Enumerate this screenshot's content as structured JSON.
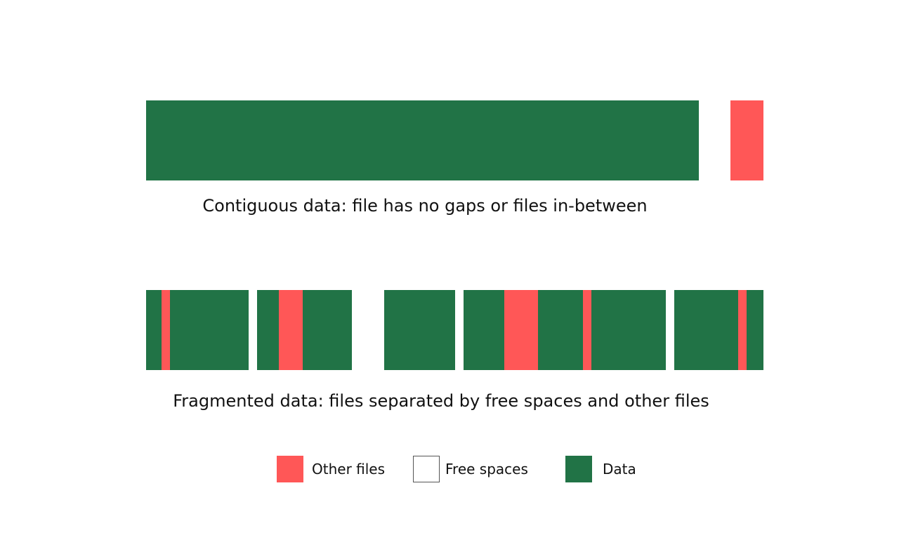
{
  "colors": {
    "data": "#217346",
    "other_files": "#FF5757",
    "free_space": "#FFFFFF"
  },
  "contiguous": {
    "caption": "Contiguous data: file has no gaps or files in-between"
  },
  "fragmented": {
    "caption": "Fragmented data: files separated by free spaces and other files"
  },
  "legend": {
    "other_files": "Other files",
    "free_spaces": "Free spaces",
    "data": "Data"
  }
}
